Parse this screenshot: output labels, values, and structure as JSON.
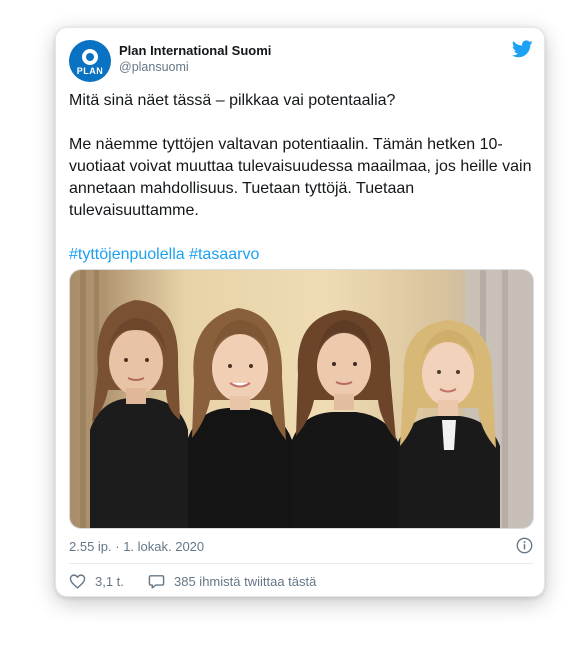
{
  "account": {
    "name": "Plan International Suomi",
    "handle": "@plansuomi",
    "logo_text": "PLAN",
    "avatar_color": "#0a72c2"
  },
  "tweet": {
    "line1": "Mitä sinä näet tässä – pilkkaa vai potentaalia?",
    "paragraph": "Me näemme tyttöjen valtavan potentiaalin. Tämän hetken 10-vuotiaat voivat muuttaa tulevaisuudessa maailmaa, jos heille vain annetaan mahdollisuus. Tuetaan tyttöjä. Tuetaan tulevaisuuttamme.",
    "hashtags": "#tyttöjenpuolella #tasaarvo"
  },
  "photo": {
    "description_icon": "group-photo"
  },
  "meta": {
    "timestamp": "2.55 ip. · 1. lokak. 2020"
  },
  "actions": {
    "likes": "3,1 t.",
    "retweet_text": "385 ihmistä twiittaa tästä"
  },
  "colors": {
    "link": "#1da1f2",
    "text": "#14171a",
    "muted": "#657786",
    "twitter_blue": "#1da1f2"
  },
  "icons": [
    "twitter-bird-icon",
    "info-icon",
    "heart-icon",
    "speech-bubble-icon"
  ]
}
